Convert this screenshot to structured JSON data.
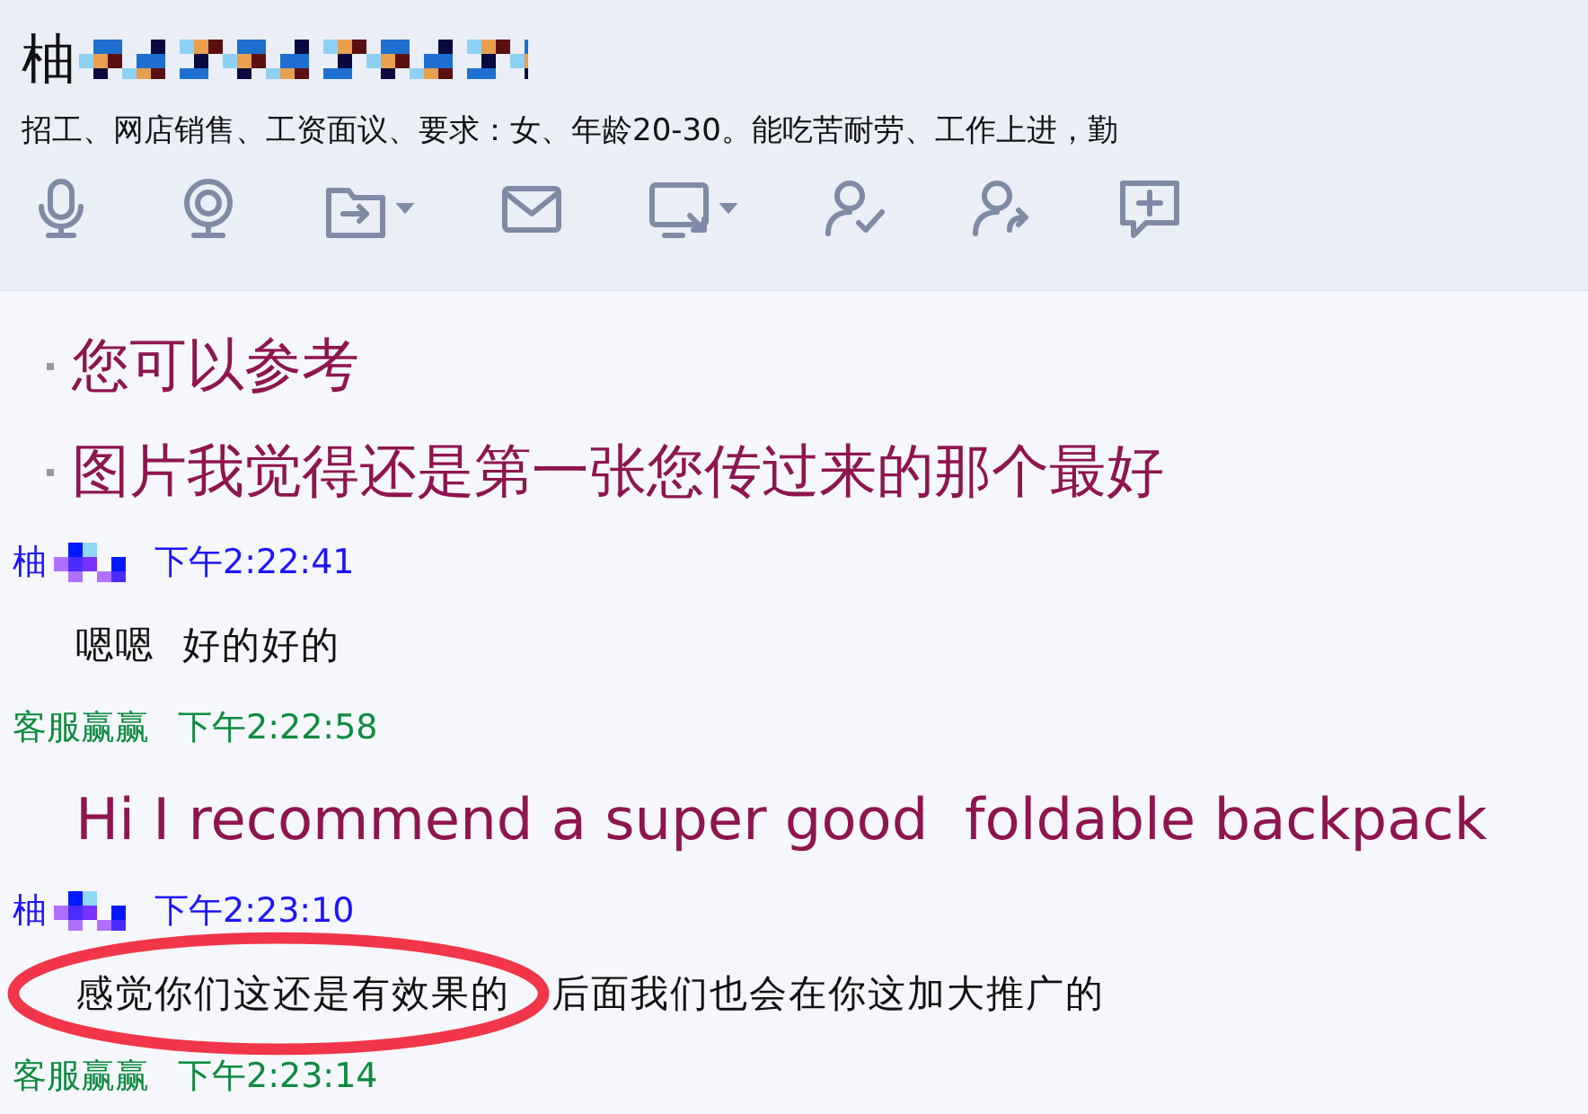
{
  "contact": {
    "name": "柚",
    "masked": true,
    "signature": "招工、网店销售、工资面议、要求：女、年龄20-30。能吃苦耐劳、工作上进，勤"
  },
  "toolbar": [
    {
      "kind": "mic",
      "caret": false
    },
    {
      "kind": "webcam",
      "caret": false
    },
    {
      "kind": "file",
      "caret": true
    },
    {
      "kind": "mail",
      "caret": false
    },
    {
      "kind": "screen",
      "caret": true
    },
    {
      "kind": "person-check",
      "caret": false
    },
    {
      "kind": "person-share",
      "caret": false
    },
    {
      "kind": "chat-plus",
      "caret": false
    }
  ],
  "messages": [
    {
      "kind": "bullet",
      "text": "您可以参考"
    },
    {
      "kind": "bullet",
      "text": "图片我觉得还是第一张您传过来的那个最好"
    },
    {
      "kind": "header",
      "sender": "柚",
      "masked": true,
      "time": "下午2:22:41",
      "color": "#1f12ff"
    },
    {
      "kind": "plain",
      "text": "嗯嗯  好的好的"
    },
    {
      "kind": "header",
      "sender": "客服赢赢",
      "masked": false,
      "time": "下午2:22:58",
      "color": "#0b8a3e"
    },
    {
      "kind": "large",
      "text": "Hi I recommend a super good  foldable backpack"
    },
    {
      "kind": "header",
      "sender": "柚",
      "masked": true,
      "time": "下午2:23:10",
      "color": "#1f12ff"
    },
    {
      "kind": "plain",
      "text": "感觉你们这还是有效果的   后面我们也会在你这加大推广的",
      "circled": true
    },
    {
      "kind": "header",
      "sender": "客服赢赢",
      "masked": false,
      "time": "下午2:23:14",
      "color": "#0b8a3e"
    }
  ]
}
